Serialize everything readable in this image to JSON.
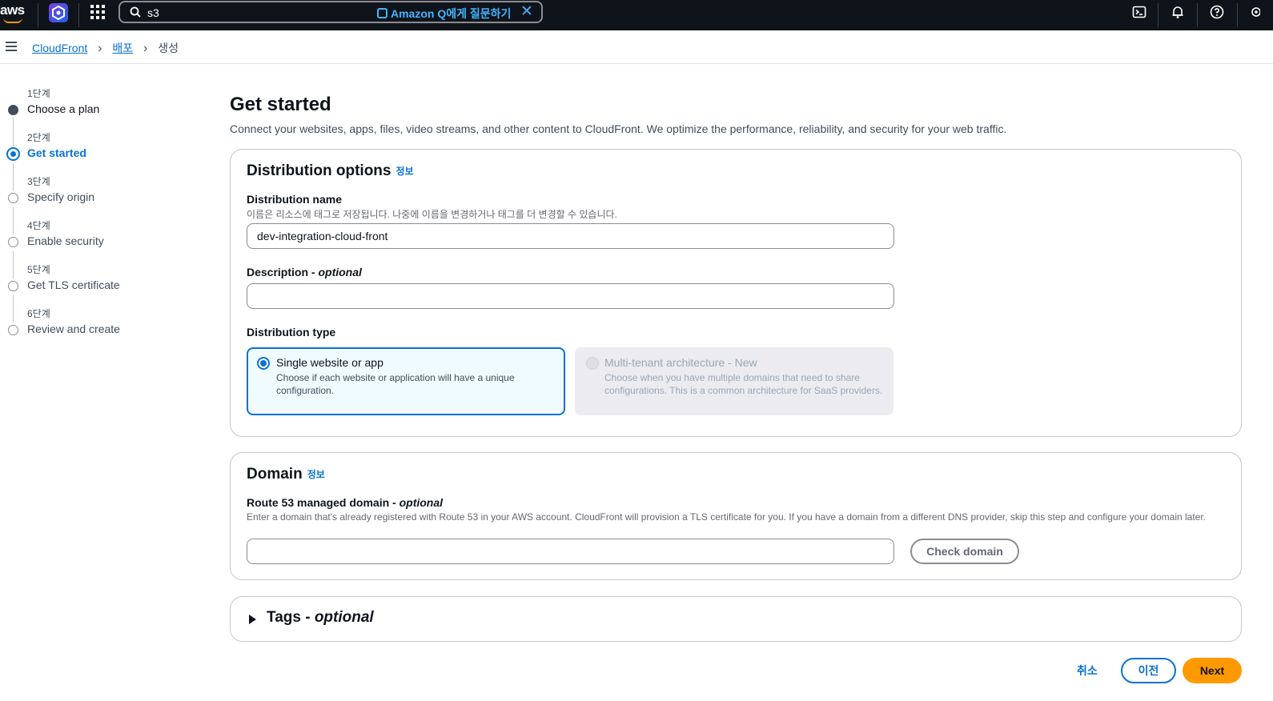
{
  "topnav": {
    "logo_text": "aws",
    "search": {
      "value": "s3"
    },
    "ask_q_label": "Amazon Q에게 질문하기",
    "clear_glyph": "✕"
  },
  "breadcrumb": {
    "items": [
      {
        "label": "CloudFront"
      },
      {
        "label": "배포"
      }
    ],
    "current": "생성",
    "separator": "›"
  },
  "steps": [
    {
      "number": "1단계",
      "label": "Choose a plan",
      "state": "done"
    },
    {
      "number": "2단계",
      "label": "Get started",
      "state": "active"
    },
    {
      "number": "3단계",
      "label": "Specify origin",
      "state": "pending"
    },
    {
      "number": "4단계",
      "label": "Enable security",
      "state": "pending"
    },
    {
      "number": "5단계",
      "label": "Get TLS certificate",
      "state": "pending"
    },
    {
      "number": "6단계",
      "label": "Review and create",
      "state": "pending"
    }
  ],
  "page": {
    "title": "Get started",
    "description": "Connect your websites, apps, files, video streams, and other content to CloudFront. We optimize the performance, reliability, and security for your web traffic."
  },
  "distribution_options": {
    "title": "Distribution options",
    "info": "정보",
    "name_label": "Distribution name",
    "name_hint": "이름은 리소스에 태그로 저장됩니다. 나중에 이름을 변경하거나 태그를 더 변경할 수 있습니다.",
    "name_value": "dev-integration-cloud-front",
    "description_label": "Description - ",
    "description_optional": "optional",
    "description_value": "",
    "type_label": "Distribution type",
    "types": [
      {
        "title": "Single website or app",
        "description": "Choose if each website or application will have a unique configuration.",
        "selected": true,
        "disabled": false
      },
      {
        "title": "Multi-tenant architecture - New",
        "description": "Choose when you have multiple domains that need to share configurations. This is a common architecture for SaaS providers.",
        "selected": false,
        "disabled": true
      }
    ]
  },
  "domain": {
    "title": "Domain",
    "info": "정보",
    "route53_label": "Route 53 managed domain - ",
    "route53_optional": "optional",
    "route53_hint": "Enter a domain that's already registered with Route 53 in your AWS account. CloudFront will provision a TLS certificate for you. If you have a domain from a different DNS provider, skip this step and configure your domain later.",
    "route53_value": "",
    "check_button": "Check domain"
  },
  "tags": {
    "title": "Tags - ",
    "optional": "optional"
  },
  "actions": {
    "cancel": "취소",
    "previous": "이전",
    "next": "Next"
  },
  "colors": {
    "nav_bg": "#0f141a",
    "link": "#0972d3",
    "primary": "#ff9900",
    "q_accent": "#42b4ff"
  }
}
